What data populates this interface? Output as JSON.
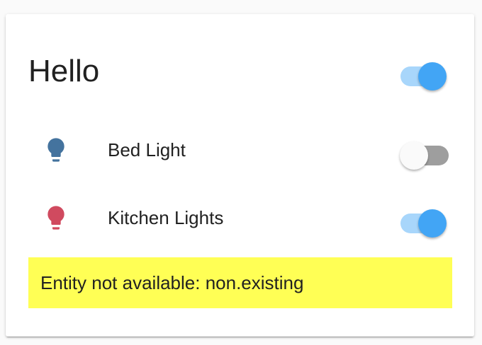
{
  "card": {
    "title": "Hello",
    "header_toggle": {
      "state": "on",
      "color": "#42a5f5"
    }
  },
  "entities": [
    {
      "name": "Bed Light",
      "icon": "lightbulb-icon",
      "icon_color": "#44739e",
      "state": "off"
    },
    {
      "name": "Kitchen Lights",
      "icon": "lightbulb-icon",
      "icon_color": "#d04a5f",
      "state": "on"
    }
  ],
  "warning": {
    "text": "Entity not available: non.existing",
    "background": "#ffff55"
  }
}
